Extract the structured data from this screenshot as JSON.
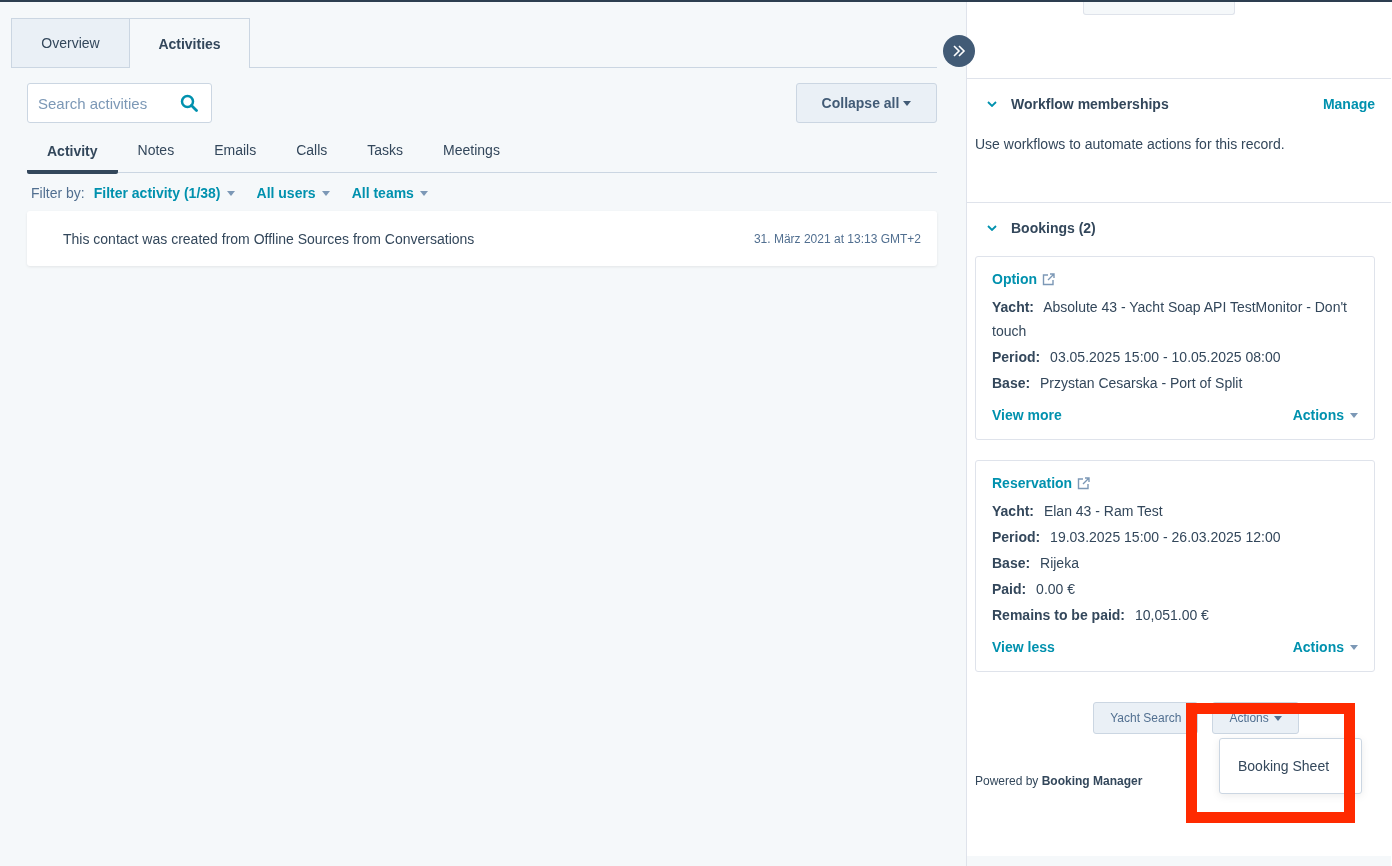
{
  "main_tabs": [
    {
      "label": "Overview",
      "selected": false
    },
    {
      "label": "Activities",
      "selected": true
    }
  ],
  "search": {
    "placeholder": "Search activities"
  },
  "collapse_button": "Collapse all",
  "activity_tabs": [
    {
      "label": "Activity",
      "selected": true
    },
    {
      "label": "Notes",
      "selected": false
    },
    {
      "label": "Emails",
      "selected": false
    },
    {
      "label": "Calls",
      "selected": false
    },
    {
      "label": "Tasks",
      "selected": false
    },
    {
      "label": "Meetings",
      "selected": false
    }
  ],
  "filter": {
    "label": "Filter by:",
    "options": [
      "Filter activity (1/38)",
      "All users",
      "All teams"
    ]
  },
  "activities": [
    {
      "text": "This contact was created from Offline Sources from Conversations",
      "time": "31. März 2021 at 13:13 GMT+2"
    }
  ],
  "sidebar": {
    "sections": [
      {
        "title": "Workflow memberships",
        "expanded": true,
        "action": "Manage",
        "text": "Use workflows to automate actions for this record."
      },
      {
        "title": "Bookings (2)",
        "expanded": true,
        "cards": [
          {
            "title": "Option",
            "fields": [
              {
                "label": "Yacht:",
                "value": "Absolute 43 - Yacht Soap API TestMonitor - Don't touch"
              },
              {
                "label": "Period:",
                "value": "03.05.2025 15:00 - 10.05.2025 08:00"
              },
              {
                "label": "Base:",
                "value": "Przystan Cesarska - Port of Split"
              }
            ],
            "toggle": "View more",
            "actions": "Actions"
          },
          {
            "title": "Reservation",
            "fields": [
              {
                "label": "Yacht:",
                "value": "Elan 43 - Ram Test"
              },
              {
                "label": "Period:",
                "value": "19.03.2025 15:00 - 26.03.2025 12:00"
              },
              {
                "label": "Base:",
                "value": "Rijeka"
              },
              {
                "label": "Paid:",
                "value": "0.00 €"
              },
              {
                "label": "Remains to be paid:",
                "value": "10,051.00 €"
              }
            ],
            "toggle": "View less",
            "actions": "Actions"
          }
        ]
      }
    ],
    "footer": {
      "buttons": [
        "Yacht Search",
        "Actions"
      ],
      "menu_open": true,
      "menu_items": [
        "Booking Sheet"
      ],
      "powered_by": "Powered by **Booking Manager**"
    }
  }
}
